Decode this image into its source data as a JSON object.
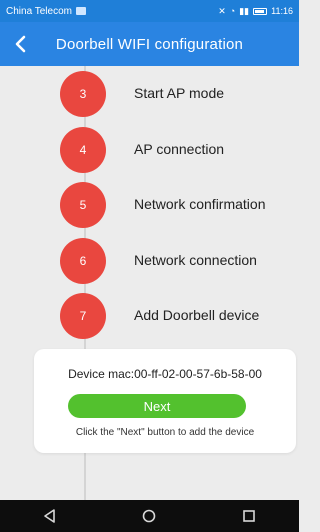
{
  "status_bar": {
    "carrier": "China Telecom",
    "time": "11:16"
  },
  "app_bar": {
    "title": "Doorbell WIFI configuration",
    "back_icon": "chevron-left-icon"
  },
  "steps": [
    {
      "number": "3",
      "label": "Start AP mode"
    },
    {
      "number": "4",
      "label": "AP connection"
    },
    {
      "number": "5",
      "label": "Network confirmation"
    },
    {
      "number": "6",
      "label": "Network connection"
    },
    {
      "number": "7",
      "label": "Add Doorbell device"
    }
  ],
  "card": {
    "mac_text": "Device mac:00-ff-02-00-57-6b-58-00",
    "next_label": "Next",
    "hint": "Click the \"Next\" button to add the device"
  },
  "colors": {
    "primary": "#2a84e2",
    "step_red": "#e9473f",
    "next_green": "#53c12e"
  },
  "nav_bar": {
    "icons": [
      "back-triangle-icon",
      "home-circle-icon",
      "recent-square-icon"
    ]
  }
}
